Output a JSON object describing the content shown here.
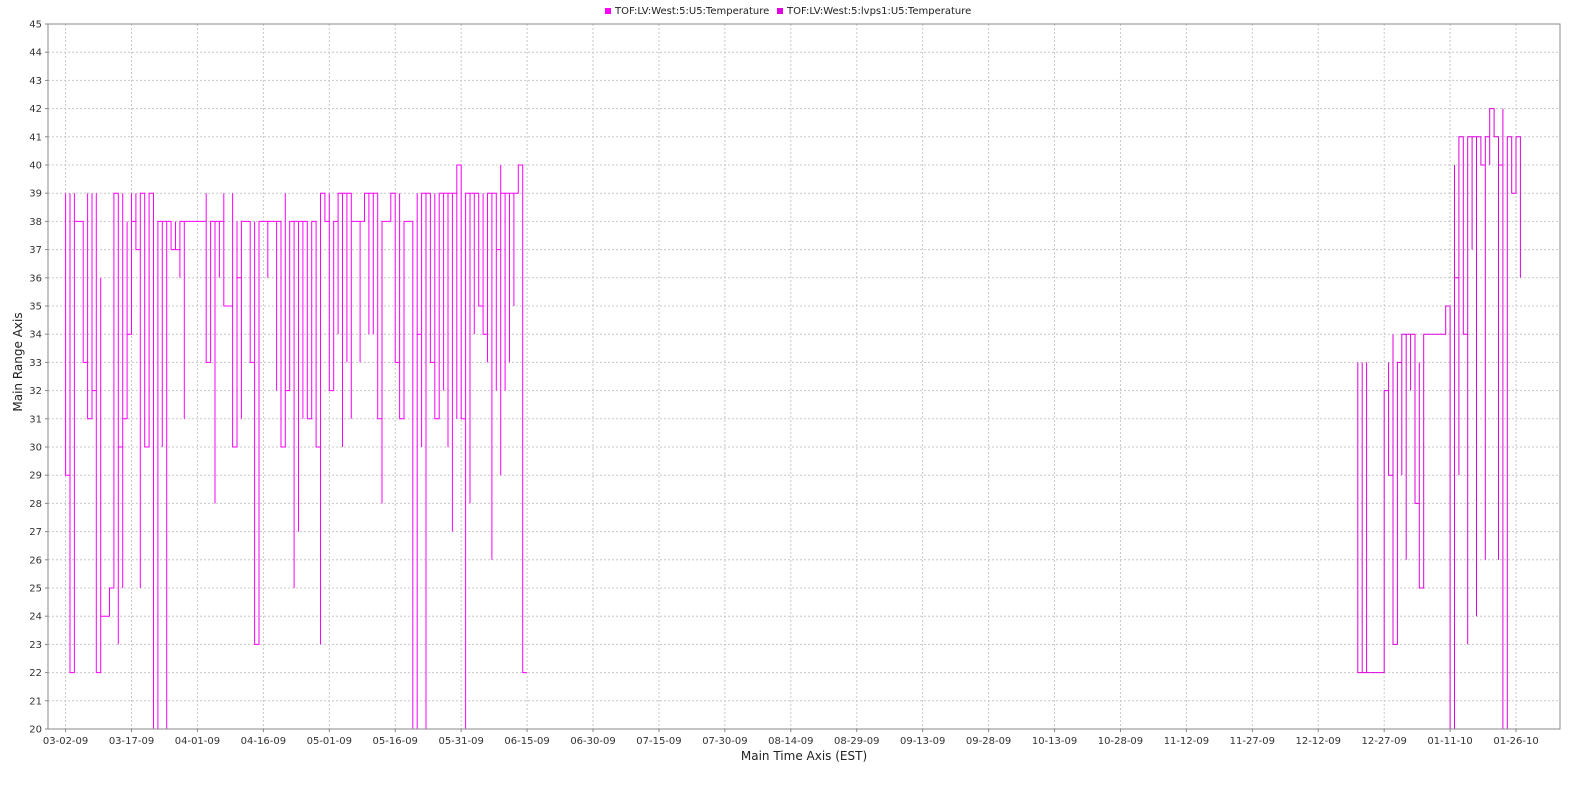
{
  "chart_data": {
    "type": "line",
    "title": "",
    "xlabel": "Main Time Axis (EST)",
    "ylabel": "Main Range Axis",
    "ylim": [
      20,
      45
    ],
    "yticks": [
      20,
      21,
      22,
      23,
      24,
      25,
      26,
      27,
      28,
      29,
      30,
      31,
      32,
      33,
      34,
      35,
      36,
      37,
      38,
      39,
      40,
      41,
      42,
      43,
      44,
      45
    ],
    "xlim": [
      "2009-02-26",
      "2010-02-05"
    ],
    "xticks": [
      {
        "label": "03-02-09",
        "date": "2009-03-02"
      },
      {
        "label": "03-17-09",
        "date": "2009-03-17"
      },
      {
        "label": "04-01-09",
        "date": "2009-04-01"
      },
      {
        "label": "04-16-09",
        "date": "2009-04-16"
      },
      {
        "label": "05-01-09",
        "date": "2009-05-01"
      },
      {
        "label": "05-16-09",
        "date": "2009-05-16"
      },
      {
        "label": "05-31-09",
        "date": "2009-05-31"
      },
      {
        "label": "06-15-09",
        "date": "2009-06-15"
      },
      {
        "label": "06-30-09",
        "date": "2009-06-30"
      },
      {
        "label": "07-15-09",
        "date": "2009-07-15"
      },
      {
        "label": "07-30-09",
        "date": "2009-07-30"
      },
      {
        "label": "08-14-09",
        "date": "2009-08-14"
      },
      {
        "label": "08-29-09",
        "date": "2009-08-29"
      },
      {
        "label": "09-13-09",
        "date": "2009-09-13"
      },
      {
        "label": "09-28-09",
        "date": "2009-09-28"
      },
      {
        "label": "10-13-09",
        "date": "2009-10-13"
      },
      {
        "label": "10-28-09",
        "date": "2009-10-28"
      },
      {
        "label": "11-12-09",
        "date": "2009-11-12"
      },
      {
        "label": "11-27-09",
        "date": "2009-11-27"
      },
      {
        "label": "12-12-09",
        "date": "2009-12-12"
      },
      {
        "label": "12-27-09",
        "date": "2009-12-27"
      },
      {
        "label": "01-11-10",
        "date": "2010-01-11"
      },
      {
        "label": "01-26-10",
        "date": "2010-01-26"
      }
    ],
    "grid": true,
    "legend_position": "top-center",
    "series": [
      {
        "name": "TOF:LV:West:5:U5:Temperature",
        "color": "#ff00ff",
        "step": true,
        "points": [
          [
            "2009-03-02",
            39
          ],
          [
            "2009-03-02",
            29
          ],
          [
            "2009-03-03",
            39
          ],
          [
            "2009-03-03",
            24
          ],
          [
            "2009-03-03",
            22
          ],
          [
            "2009-03-04",
            39
          ],
          [
            "2009-03-04",
            30
          ],
          [
            "2009-03-04",
            38
          ],
          [
            "2009-03-06",
            38
          ],
          [
            "2009-03-06",
            33
          ],
          [
            "2009-03-07",
            39
          ],
          [
            "2009-03-07",
            31
          ],
          [
            "2009-03-08",
            39
          ],
          [
            "2009-03-08",
            32
          ],
          [
            "2009-03-09",
            39
          ],
          [
            "2009-03-09",
            22
          ],
          [
            "2009-03-10",
            36
          ],
          [
            "2009-03-10",
            24
          ],
          [
            "2009-03-12",
            24
          ],
          [
            "2009-03-12",
            25
          ],
          [
            "2009-03-13",
            38
          ],
          [
            "2009-03-13",
            39
          ],
          [
            "2009-03-14",
            39
          ],
          [
            "2009-03-14",
            23
          ],
          [
            "2009-03-14",
            30
          ],
          [
            "2009-03-15",
            39
          ],
          [
            "2009-03-15",
            25
          ],
          [
            "2009-03-15",
            31
          ],
          [
            "2009-03-16",
            38
          ],
          [
            "2009-03-16",
            34
          ],
          [
            "2009-03-17",
            39
          ],
          [
            "2009-03-17",
            38
          ],
          [
            "2009-03-18",
            39
          ],
          [
            "2009-03-18",
            37
          ],
          [
            "2009-03-19",
            25
          ],
          [
            "2009-03-19",
            39
          ],
          [
            "2009-03-20",
            38
          ],
          [
            "2009-03-20",
            30
          ],
          [
            "2009-03-21",
            39
          ],
          [
            "2009-03-22",
            38
          ],
          [
            "2009-03-22",
            20
          ],
          [
            "2009-03-23",
            38
          ],
          [
            "2009-03-24",
            30
          ],
          [
            "2009-03-24",
            38
          ],
          [
            "2009-03-25",
            20
          ],
          [
            "2009-03-25",
            38
          ],
          [
            "2009-03-26",
            37
          ],
          [
            "2009-03-27",
            38
          ],
          [
            "2009-03-27",
            37
          ],
          [
            "2009-03-28",
            36
          ],
          [
            "2009-03-28",
            38
          ],
          [
            "2009-03-29",
            31
          ],
          [
            "2009-03-29",
            38
          ],
          [
            "2009-04-03",
            38
          ],
          [
            "2009-04-03",
            39
          ],
          [
            "2009-04-03",
            33
          ],
          [
            "2009-04-04",
            35
          ],
          [
            "2009-04-04",
            38
          ],
          [
            "2009-04-05",
            28
          ],
          [
            "2009-04-05",
            38
          ],
          [
            "2009-04-06",
            36
          ],
          [
            "2009-04-06",
            38
          ],
          [
            "2009-04-07",
            39
          ],
          [
            "2009-04-07",
            35
          ],
          [
            "2009-04-09",
            39
          ],
          [
            "2009-04-09",
            30
          ],
          [
            "2009-04-10",
            38
          ],
          [
            "2009-04-10",
            36
          ],
          [
            "2009-04-11",
            31
          ],
          [
            "2009-04-11",
            38
          ],
          [
            "2009-04-13",
            38
          ],
          [
            "2009-04-13",
            33
          ],
          [
            "2009-04-14",
            38
          ],
          [
            "2009-04-14",
            23
          ],
          [
            "2009-04-15",
            38
          ],
          [
            "2009-04-17",
            36
          ],
          [
            "2009-04-17",
            38
          ],
          [
            "2009-04-19",
            32
          ],
          [
            "2009-04-19",
            38
          ],
          [
            "2009-04-20",
            30
          ],
          [
            "2009-04-21",
            39
          ],
          [
            "2009-04-21",
            32
          ],
          [
            "2009-04-22",
            38
          ],
          [
            "2009-04-23",
            25
          ],
          [
            "2009-04-23",
            38
          ],
          [
            "2009-04-24",
            27
          ],
          [
            "2009-04-24",
            38
          ],
          [
            "2009-04-25",
            31
          ],
          [
            "2009-04-25",
            38
          ],
          [
            "2009-04-26",
            31
          ],
          [
            "2009-04-27",
            38
          ],
          [
            "2009-04-28",
            30
          ],
          [
            "2009-04-29",
            23
          ],
          [
            "2009-04-29",
            39
          ],
          [
            "2009-04-30",
            38
          ],
          [
            "2009-05-01",
            39
          ],
          [
            "2009-05-01",
            32
          ],
          [
            "2009-05-02",
            38
          ],
          [
            "2009-05-03",
            34
          ],
          [
            "2009-05-03",
            39
          ],
          [
            "2009-05-04",
            30
          ],
          [
            "2009-05-04",
            39
          ],
          [
            "2009-05-05",
            33
          ],
          [
            "2009-05-05",
            39
          ],
          [
            "2009-05-06",
            31
          ],
          [
            "2009-05-06",
            38
          ],
          [
            "2009-05-08",
            33
          ],
          [
            "2009-05-08",
            38
          ],
          [
            "2009-05-09",
            39
          ],
          [
            "2009-05-10",
            34
          ],
          [
            "2009-05-10",
            39
          ],
          [
            "2009-05-11",
            34
          ],
          [
            "2009-05-11",
            39
          ],
          [
            "2009-05-12",
            31
          ],
          [
            "2009-05-13",
            28
          ],
          [
            "2009-05-13",
            38
          ],
          [
            "2009-05-15",
            38
          ],
          [
            "2009-05-15",
            39
          ],
          [
            "2009-05-16",
            33
          ],
          [
            "2009-05-17",
            39
          ],
          [
            "2009-05-17",
            31
          ],
          [
            "2009-05-18",
            38
          ],
          [
            "2009-05-19",
            38
          ],
          [
            "2009-05-20",
            34
          ],
          [
            "2009-05-20",
            20
          ],
          [
            "2009-05-21",
            39
          ],
          [
            "2009-05-21",
            34
          ],
          [
            "2009-05-22",
            30
          ],
          [
            "2009-05-22",
            39
          ],
          [
            "2009-05-23",
            20
          ],
          [
            "2009-05-23",
            39
          ],
          [
            "2009-05-24",
            33
          ],
          [
            "2009-05-25",
            39
          ],
          [
            "2009-05-25",
            31
          ],
          [
            "2009-05-26",
            39
          ],
          [
            "2009-05-27",
            32
          ],
          [
            "2009-05-27",
            39
          ],
          [
            "2009-05-28",
            30
          ],
          [
            "2009-05-28",
            39
          ],
          [
            "2009-05-29",
            27
          ],
          [
            "2009-05-29",
            39
          ],
          [
            "2009-05-30",
            31
          ],
          [
            "2009-05-30",
            40
          ],
          [
            "2009-05-31",
            31
          ],
          [
            "2009-06-01",
            20
          ],
          [
            "2009-06-01",
            39
          ],
          [
            "2009-06-02",
            28
          ],
          [
            "2009-06-02",
            39
          ],
          [
            "2009-06-03",
            34
          ],
          [
            "2009-06-03",
            39
          ],
          [
            "2009-06-04",
            35
          ],
          [
            "2009-06-05",
            39
          ],
          [
            "2009-06-05",
            34
          ],
          [
            "2009-06-06",
            33
          ],
          [
            "2009-06-06",
            39
          ],
          [
            "2009-06-07",
            26
          ],
          [
            "2009-06-07",
            39
          ],
          [
            "2009-06-08",
            32
          ],
          [
            "2009-06-08",
            37
          ],
          [
            "2009-06-09",
            40
          ],
          [
            "2009-06-09",
            29
          ],
          [
            "2009-06-09",
            39
          ],
          [
            "2009-06-10",
            32
          ],
          [
            "2009-06-10",
            39
          ],
          [
            "2009-06-11",
            33
          ],
          [
            "2009-06-11",
            39
          ],
          [
            "2009-06-12",
            35
          ],
          [
            "2009-06-12",
            39
          ],
          [
            "2009-06-13",
            40
          ],
          [
            "2009-06-14",
            37
          ],
          [
            "2009-06-14",
            39
          ],
          [
            "2009-06-14",
            22
          ],
          [
            "2009-06-15",
            22
          ]
        ]
      },
      {
        "name": "TOF:LV:West:5:lvps1:U5:Temperature",
        "color": "#e000e0",
        "step": true,
        "points": [
          [
            "2009-12-21",
            33
          ],
          [
            "2009-12-21",
            22
          ],
          [
            "2009-12-22",
            33
          ],
          [
            "2009-12-22",
            22
          ],
          [
            "2009-12-23",
            33
          ],
          [
            "2009-12-23",
            22
          ],
          [
            "2009-12-27",
            22
          ],
          [
            "2009-12-27",
            32
          ],
          [
            "2009-12-28",
            33
          ],
          [
            "2009-12-28",
            29
          ],
          [
            "2009-12-29",
            34
          ],
          [
            "2009-12-29",
            23
          ],
          [
            "2009-12-30",
            33
          ],
          [
            "2009-12-31",
            29
          ],
          [
            "2009-12-31",
            34
          ],
          [
            "2010-01-01",
            26
          ],
          [
            "2010-01-01",
            34
          ],
          [
            "2010-01-02",
            32
          ],
          [
            "2010-01-02",
            34
          ],
          [
            "2010-01-03",
            28
          ],
          [
            "2010-01-04",
            33
          ],
          [
            "2010-01-04",
            25
          ],
          [
            "2010-01-05",
            33
          ],
          [
            "2010-01-05",
            31
          ],
          [
            "2010-01-05",
            34
          ],
          [
            "2010-01-10",
            34
          ],
          [
            "2010-01-10",
            35
          ],
          [
            "2010-01-11",
            33
          ],
          [
            "2010-01-11",
            28
          ],
          [
            "2010-01-11",
            20
          ],
          [
            "2010-01-12",
            40
          ],
          [
            "2010-01-12",
            36
          ],
          [
            "2010-01-13",
            29
          ],
          [
            "2010-01-13",
            41
          ],
          [
            "2010-01-14",
            36
          ],
          [
            "2010-01-14",
            34
          ],
          [
            "2010-01-15",
            23
          ],
          [
            "2010-01-15",
            41
          ],
          [
            "2010-01-16",
            37
          ],
          [
            "2010-01-16",
            41
          ],
          [
            "2010-01-17",
            24
          ],
          [
            "2010-01-17",
            41
          ],
          [
            "2010-01-18",
            40
          ],
          [
            "2010-01-19",
            26
          ],
          [
            "2010-01-19",
            41
          ],
          [
            "2010-01-20",
            40
          ],
          [
            "2010-01-20",
            42
          ],
          [
            "2010-01-21",
            41
          ],
          [
            "2010-01-22",
            26
          ],
          [
            "2010-01-22",
            40
          ],
          [
            "2010-01-23",
            42
          ],
          [
            "2010-01-23",
            20
          ],
          [
            "2010-01-24",
            41
          ],
          [
            "2010-01-25",
            39
          ],
          [
            "2010-01-26",
            41
          ],
          [
            "2010-01-27",
            36
          ],
          [
            "2010-01-27",
            41
          ]
        ]
      }
    ]
  }
}
